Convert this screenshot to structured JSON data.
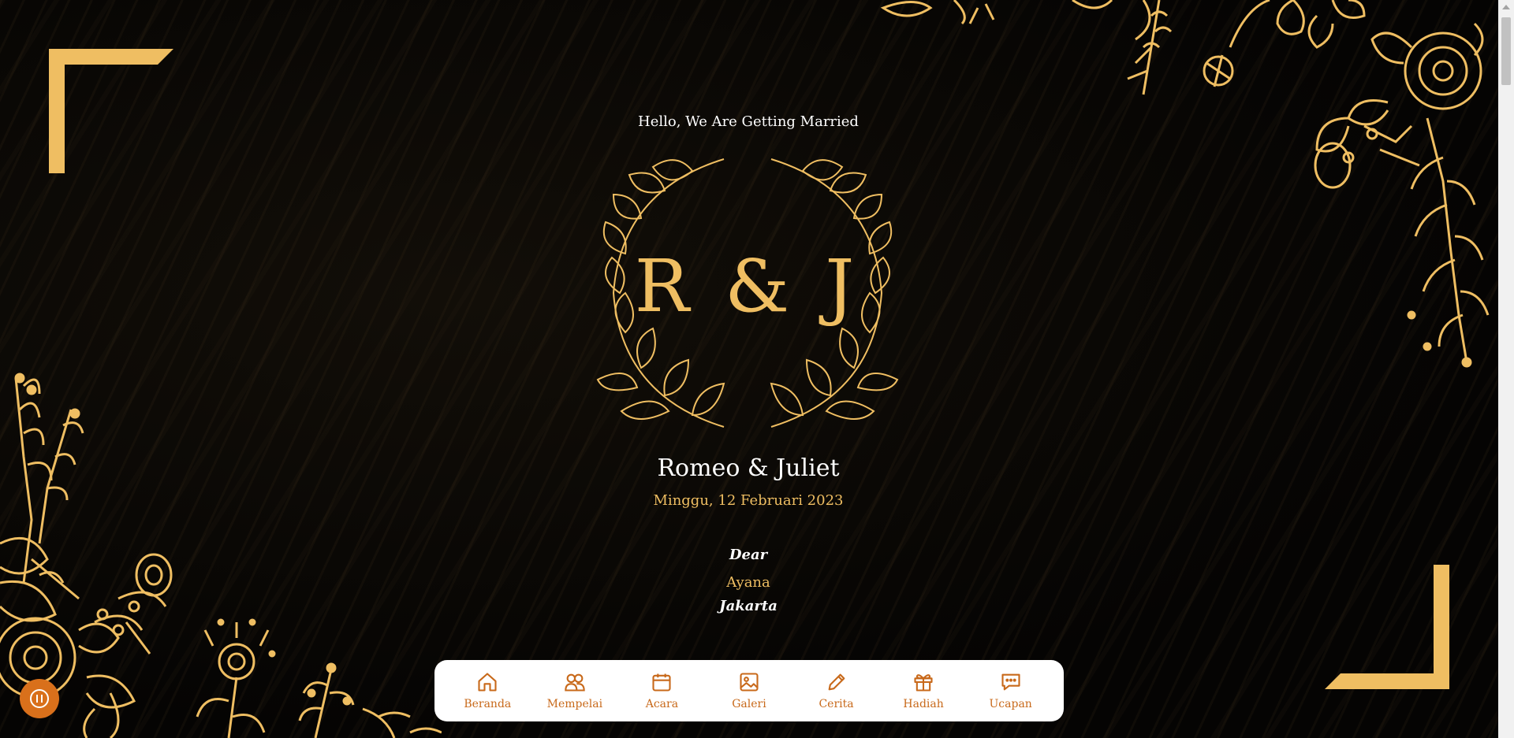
{
  "hero": {
    "greeting": "Hello, We Are Getting Married",
    "monogram": "R & J",
    "couple_names": "Romeo & Juliet",
    "date": "Minggu, 12 Februari 2023"
  },
  "invitation": {
    "salutation": "Dear",
    "guest_name": "Ayana",
    "guest_city": "Jakarta"
  },
  "nav": {
    "items": [
      {
        "label": "Beranda",
        "icon": "home-icon"
      },
      {
        "label": "Mempelai",
        "icon": "couple-icon"
      },
      {
        "label": "Acara",
        "icon": "calendar-icon"
      },
      {
        "label": "Galeri",
        "icon": "image-icon"
      },
      {
        "label": "Cerita",
        "icon": "pencil-icon"
      },
      {
        "label": "Hadiah",
        "icon": "gift-icon"
      },
      {
        "label": "Ucapan",
        "icon": "chat-icon"
      }
    ]
  },
  "music": {
    "icon": "pause-icon",
    "color": "#d9701b"
  },
  "colors": {
    "gold": "#efbe62",
    "nav_accent": "#c8691a",
    "background": "#050403"
  }
}
